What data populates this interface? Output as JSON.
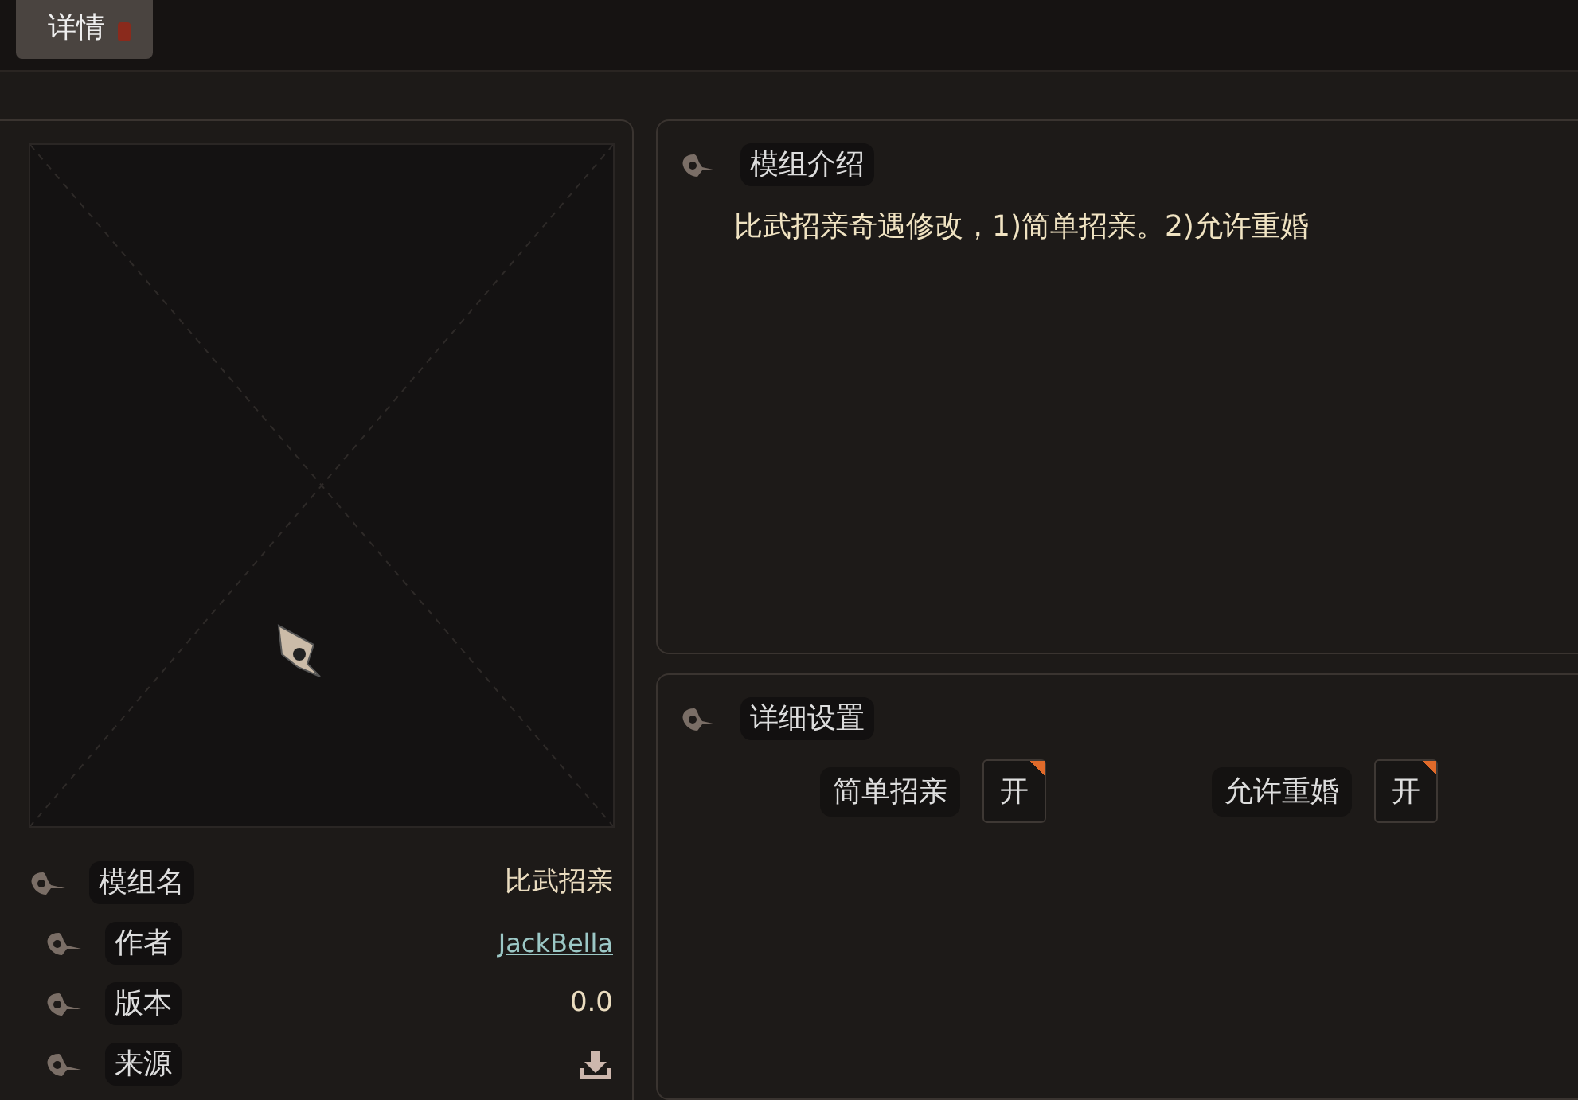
{
  "tabs": [
    {
      "label": "详情",
      "selected": true
    }
  ],
  "preview": {
    "kind": "placeholder"
  },
  "info": [
    {
      "label": "模组名",
      "value": "比武招亲",
      "kind": "text"
    },
    {
      "label": "作者",
      "value": "JackBella",
      "kind": "link"
    },
    {
      "label": "版本",
      "value": "0.0",
      "kind": "text"
    },
    {
      "label": "来源",
      "kind": "download"
    }
  ],
  "description": {
    "title": "模组介绍",
    "text": "比武招亲奇遇修改，1)简单招亲。2)允许重婚"
  },
  "settings": {
    "title": "详细设置",
    "options": [
      {
        "label": "简单招亲",
        "value": "开",
        "on": true
      },
      {
        "label": "允许重婚",
        "value": "开",
        "on": true
      }
    ]
  }
}
